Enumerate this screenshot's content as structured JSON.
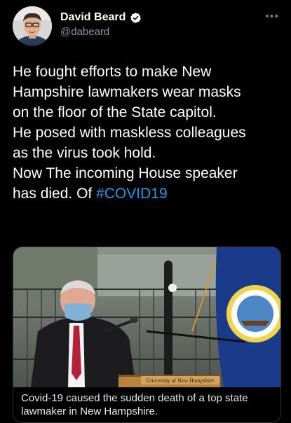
{
  "author": {
    "display_name": "David Beard",
    "handle": "@dabeard",
    "verified": true,
    "avatar_icon": "profile-photo"
  },
  "more_icon": "more-options-icon",
  "tweet": {
    "lines": [
      "He fought efforts to make New",
      "Hampshire lawmakers wear masks",
      "on the floor of the State capitol.",
      "He posed with maskless colleagues",
      "as the virus took hold.",
      "Now The incoming House speaker",
      "has died. Of "
    ],
    "hashtag": "#COVID19"
  },
  "card": {
    "podium_sign": "University of New Hampshire",
    "caption": "Covid-19 caused the sudden death of a top state lawmaker in New Hampshire."
  },
  "colors": {
    "background": "#000000",
    "text": "#ffffff",
    "secondary_text": "#8b98a5",
    "link": "#1d9bf0",
    "verified_badge": "#ffffff"
  }
}
